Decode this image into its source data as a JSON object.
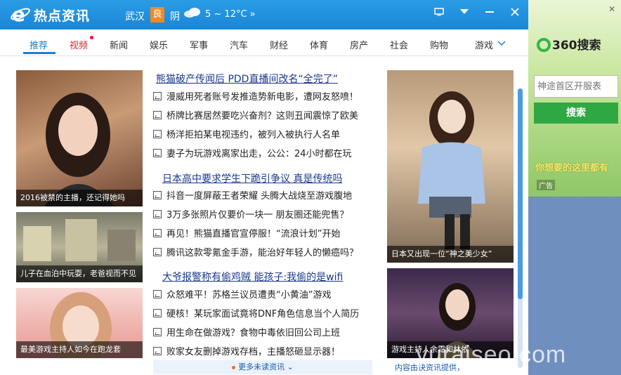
{
  "header": {
    "title": "热点资讯",
    "city": "武汉",
    "aqi": "良",
    "weather": "阴",
    "temperature": "5 ~ 12°C »"
  },
  "tabs": [
    "推荐",
    "视频",
    "新闻",
    "娱乐",
    "军事",
    "汽车",
    "财经",
    "体育",
    "房产",
    "社会",
    "购物",
    "游戏"
  ],
  "images": {
    "left1_caption": "2016被禁的主播，还记得她吗",
    "left2_caption": "儿子在血泊中玩耍，老爸视而不见",
    "left3_caption": "最美游戏主持人如今在跑龙套",
    "right1_caption": "日本又出现一位“神之美少女”",
    "right2_caption": "游戏主持人余霜和林依"
  },
  "groups": [
    {
      "headline": "熊猫破产传闻后 PDD直播间改名“全完了”",
      "items": [
        "漫威用死者账号发推造势新电影，遭网友怒喷！",
        "桥牌比赛居然要吃兴奋剂？这则丑闻震惊了欧美",
        "杨洋拒拍某电视违约，被列入被执行人名单",
        "妻子为玩游戏离家出走，公公：24小时都在玩"
      ]
    },
    {
      "headline": "日本高中要求学生下跪引争议 真是传统吗",
      "items": [
        "抖音一度屏蔽王者荣耀 头腾大战烧至游戏腹地",
        "3万多张照片仅要价一块一 朋友圈还能兜售？",
        "再见！熊猫直播官宣停服！“流浪计划”开始",
        "腾讯这款零氪金手游，能治好年轻人的懒癌吗？"
      ]
    },
    {
      "headline": "大爷报警称有偷鸡贼 能孩子:我偷的是wifi",
      "items": [
        "众怒难平！苏格兰议员遭责“小黄油”游戏",
        "硬核！某玩家面试竟将DNF角色信息当个人简历",
        "用生命在做游戏？食物中毒依旧回公司上班",
        "败家女友删掉游戏存档，主播怒砸显示器！"
      ]
    }
  ],
  "footer": {
    "more": "更多未读资讯",
    "source": "内容由快资讯提供，"
  },
  "ad": {
    "logo": "360搜索",
    "input_placeholder": "神途首区开服表",
    "button": "搜索",
    "slogan": "你想要的这里都有",
    "tag": "广告"
  },
  "watermark": "yuraiseo.com"
}
